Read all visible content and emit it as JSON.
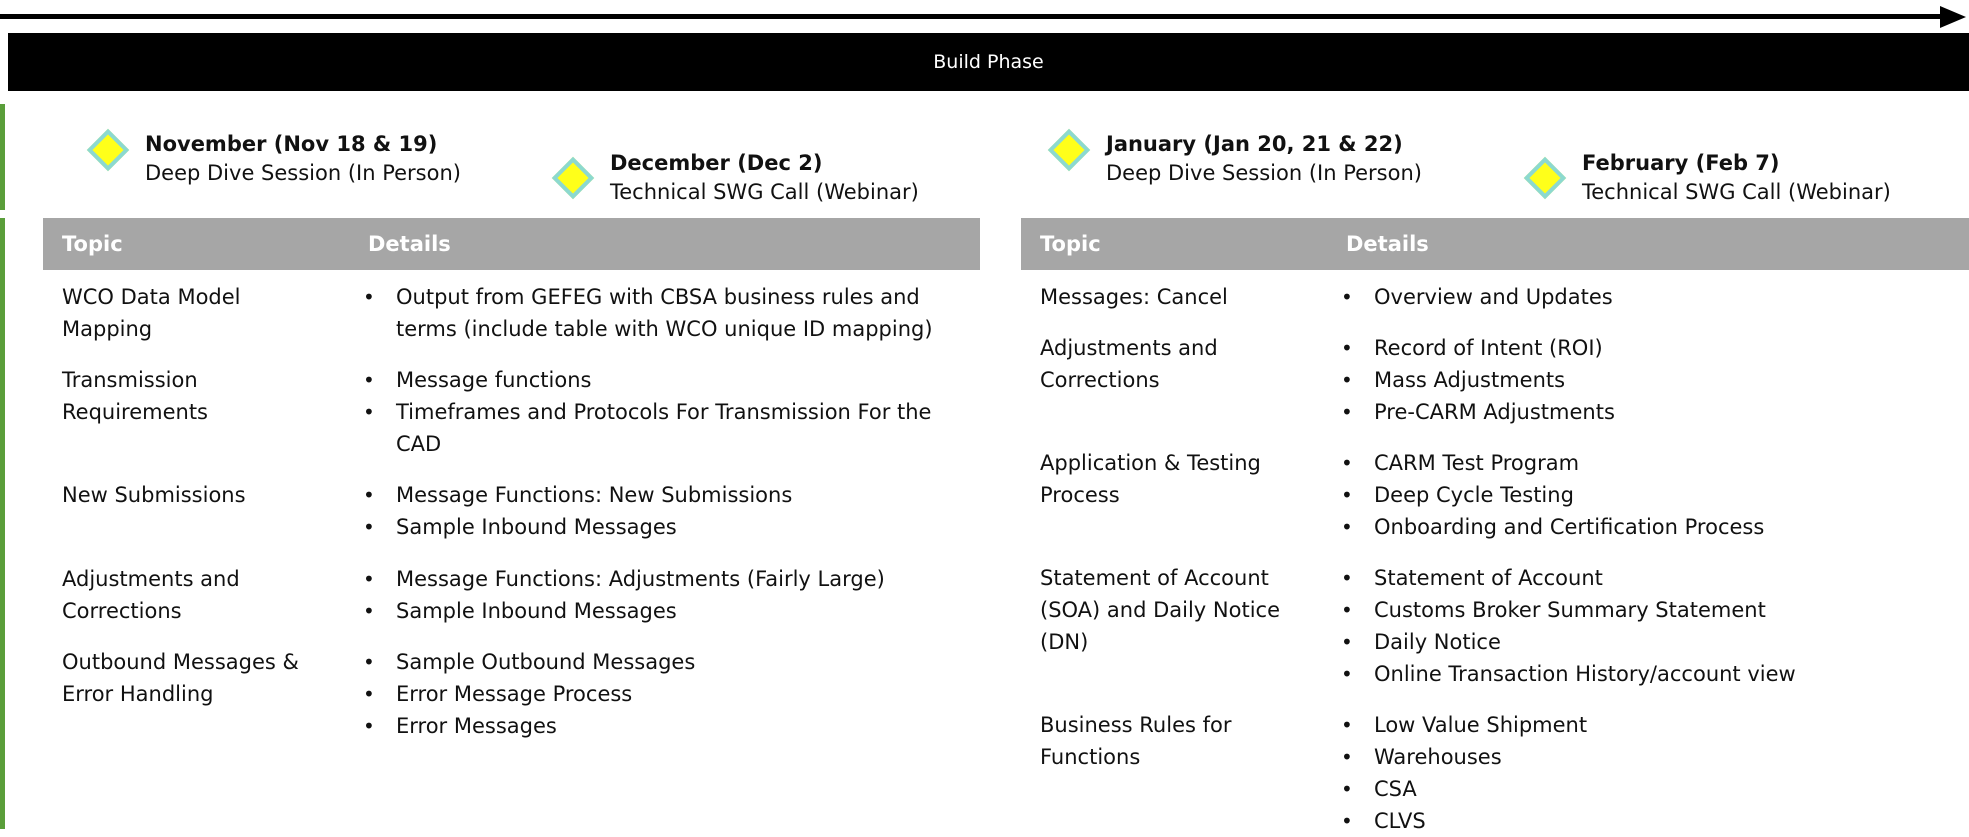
{
  "phase_title": "Build Phase",
  "milestones": [
    {
      "title": "November (Nov 18 & 19)",
      "subtitle": "Deep Dive Session (In Person)"
    },
    {
      "title": "December (Dec 2)",
      "subtitle": "Technical SWG Call (Webinar)"
    },
    {
      "title": "January (Jan 20, 21 & 22)",
      "subtitle": "Deep Dive Session (In Person)"
    },
    {
      "title": "February (Feb 7)",
      "subtitle": "Technical SWG Call (Webinar)"
    }
  ],
  "left_table": {
    "headers": {
      "topic": "Topic",
      "details": "Details"
    },
    "rows": [
      {
        "topic": "WCO Data Model Mapping",
        "details": [
          "Output from GEFEG with CBSA business rules and terms (include table with WCO unique ID mapping)"
        ]
      },
      {
        "topic": "Transmission Requirements",
        "details": [
          "Message functions",
          "Timeframes and Protocols For Transmission For the CAD"
        ]
      },
      {
        "topic": "New Submissions",
        "details": [
          "Message Functions: New Submissions",
          "Sample Inbound Messages"
        ]
      },
      {
        "topic": "Adjustments and Corrections",
        "details": [
          "Message Functions: Adjustments (Fairly Large)",
          "Sample Inbound Messages"
        ]
      },
      {
        "topic": "Outbound Messages & Error Handling",
        "details": [
          "Sample Outbound Messages",
          "Error Message Process",
          "Error Messages"
        ]
      }
    ]
  },
  "right_table": {
    "headers": {
      "topic": "Topic",
      "details": "Details"
    },
    "rows": [
      {
        "topic": "Messages: Cancel",
        "details": [
          "Overview and Updates"
        ]
      },
      {
        "topic": "Adjustments and Corrections",
        "details": [
          "Record of Intent (ROI)",
          "Mass Adjustments",
          "Pre-CARM Adjustments"
        ]
      },
      {
        "topic": "Application & Testing Process",
        "details": [
          "CARM Test Program",
          "Deep Cycle Testing",
          "Onboarding and Certification Process"
        ]
      },
      {
        "topic": "Statement of Account (SOA) and Daily Notice (DN)",
        "details": [
          "Statement of Account",
          "Customs Broker Summary Statement",
          "Daily Notice",
          "Online Transaction History/account view"
        ]
      },
      {
        "topic": "Business Rules for Functions",
        "details": [
          "Low Value Shipment",
          "Warehouses",
          "CSA",
          "CLVS"
        ]
      }
    ]
  }
}
